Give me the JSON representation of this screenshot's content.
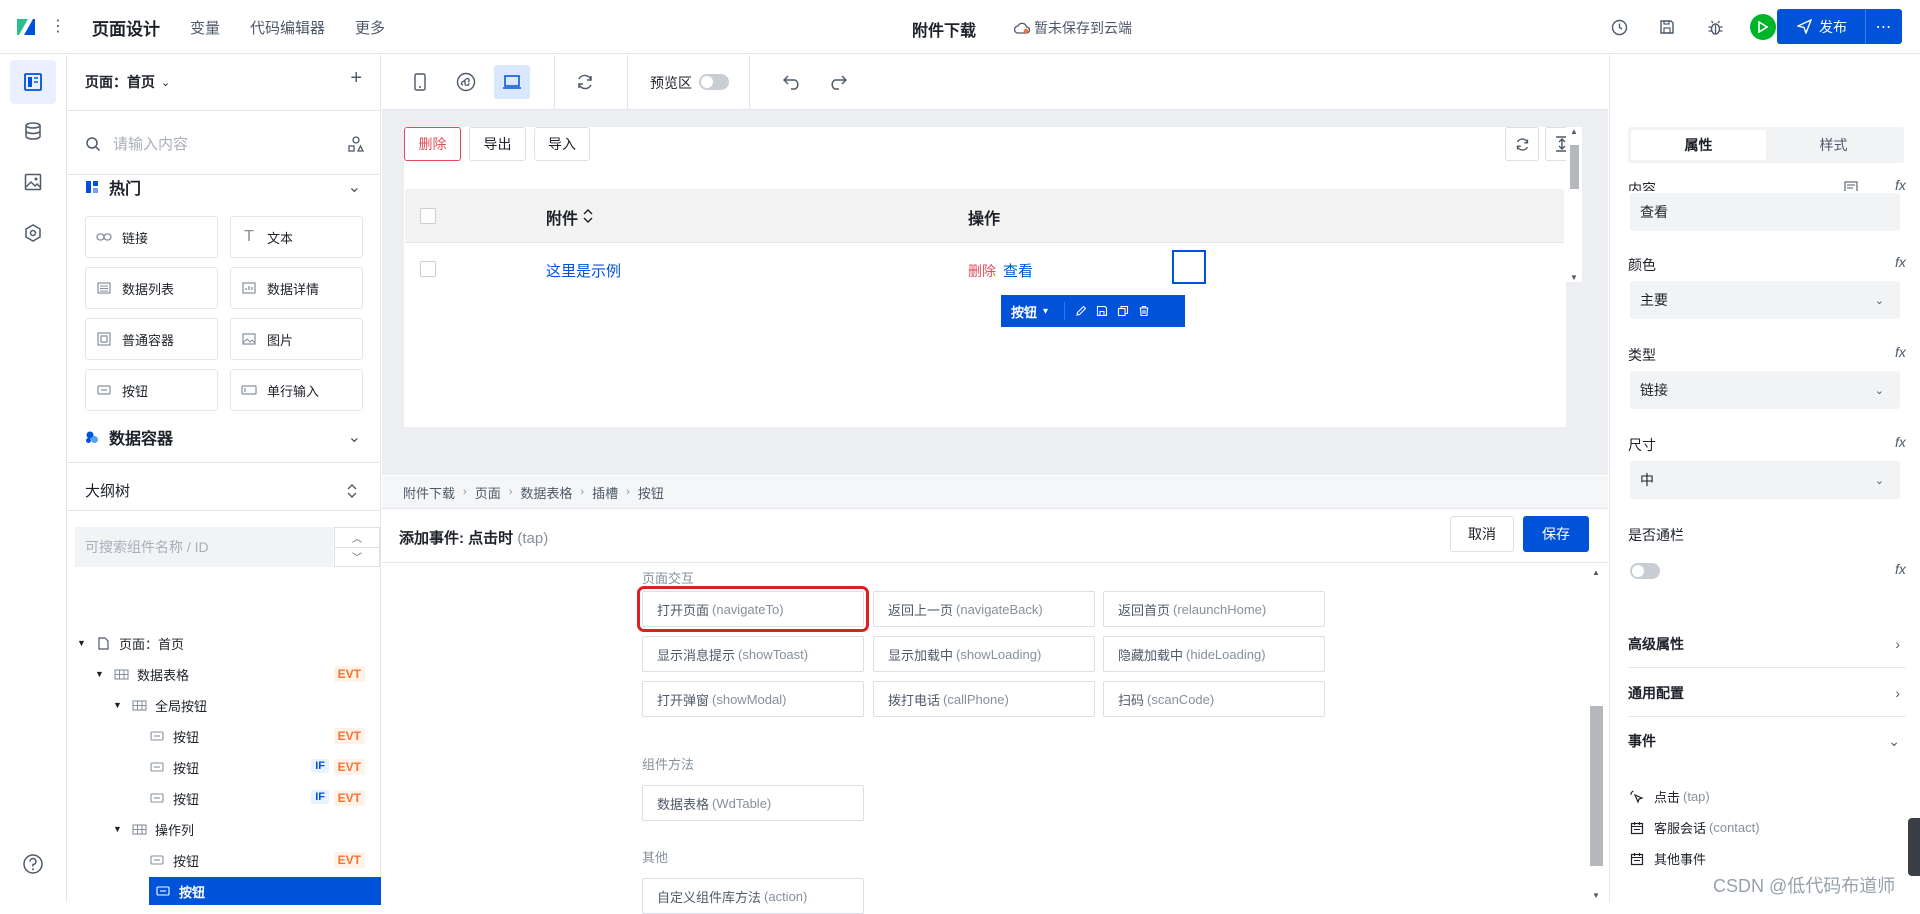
{
  "topbar": {
    "nav": [
      "页面设计",
      "变量",
      "代码编辑器",
      "更多"
    ],
    "app_title": "附件下载",
    "save_status": "暂未保存到云端",
    "publish_label": "发布",
    "more_label": "⋯"
  },
  "left_panel": {
    "page_selector": "页面：首页",
    "search_placeholder": "请输入内容",
    "hot_category": "热门",
    "components": [
      {
        "label": "链接",
        "icon": "link-icon"
      },
      {
        "label": "文本",
        "icon": "text-icon"
      },
      {
        "label": "数据列表",
        "icon": "data-list-icon"
      },
      {
        "label": "数据详情",
        "icon": "data-detail-icon"
      },
      {
        "label": "普通容器",
        "icon": "container-icon"
      },
      {
        "label": "图片",
        "icon": "image-icon"
      },
      {
        "label": "按钮",
        "icon": "button-icon"
      },
      {
        "label": "单行输入",
        "icon": "input-icon"
      }
    ],
    "data_container_category": "数据容器",
    "outline_title": "大纲树",
    "outline_search_placeholder": "可搜索组件名称 / ID",
    "tree": [
      {
        "label": "页面：首页",
        "level": 0,
        "evt": false,
        "if": false
      },
      {
        "label": "数据表格",
        "level": 1,
        "evt": true,
        "if": false
      },
      {
        "label": "全局按钮",
        "level": 2,
        "evt": false,
        "if": false
      },
      {
        "label": "按钮",
        "level": 3,
        "evt": true,
        "if": false
      },
      {
        "label": "按钮",
        "level": 3,
        "evt": true,
        "if": true
      },
      {
        "label": "按钮",
        "level": 3,
        "evt": true,
        "if": true
      },
      {
        "label": "操作列",
        "level": 2,
        "evt": false,
        "if": false
      },
      {
        "label": "按钮",
        "level": 3,
        "evt": true,
        "if": false
      },
      {
        "label": "按钮",
        "level": 3,
        "evt": false,
        "if": false,
        "selected": true
      }
    ],
    "tag_evt": "EVT",
    "tag_if": "IF"
  },
  "toolbar": {
    "preview_label": "预览区",
    "preview_on": false
  },
  "canvas": {
    "btn_delete": "删除",
    "btn_export": "导出",
    "btn_import": "导入",
    "col_attachment": "附件",
    "col_actions": "操作",
    "row_link": "这里是示例",
    "row_delete": "删除",
    "row_view": "查看",
    "component_bar_label": "按钮"
  },
  "breadcrumb": [
    "附件下载",
    "页面",
    "数据表格",
    "插槽",
    "按钮"
  ],
  "event_panel": {
    "title": "添加事件: 点击时",
    "title_sub": "(tap)",
    "cancel": "取消",
    "save": "保存",
    "sections": [
      {
        "title": "页面交互",
        "actions": [
          {
            "cn": "打开页面",
            "en": "(navigateTo)",
            "highlighted": true
          },
          {
            "cn": "返回上一页",
            "en": "(navigateBack)"
          },
          {
            "cn": "返回首页",
            "en": "(relaunchHome)"
          },
          {
            "cn": "显示消息提示",
            "en": "(showToast)"
          },
          {
            "cn": "显示加载中",
            "en": "(showLoading)"
          },
          {
            "cn": "隐藏加载中",
            "en": "(hideLoading)"
          },
          {
            "cn": "打开弹窗",
            "en": "(showModal)"
          },
          {
            "cn": "拨打电话",
            "en": "(callPhone)"
          },
          {
            "cn": "扫码",
            "en": "(scanCode)"
          }
        ]
      },
      {
        "title": "组件方法",
        "actions": [
          {
            "cn": "数据表格",
            "en": "(WdTable)"
          }
        ]
      },
      {
        "title": "其他",
        "actions": [
          {
            "cn": "自定义组件库方法",
            "en": "(action)"
          }
        ]
      }
    ]
  },
  "right_panel": {
    "tab_props": "属性",
    "tab_style": "样式",
    "content_label": "内容",
    "content_value": "查看",
    "color_label": "颜色",
    "color_value": "主要",
    "type_label": "类型",
    "type_value": "链接",
    "size_label": "尺寸",
    "size_value": "中",
    "block_label": "是否通栏",
    "block_on": false,
    "fx": "fx",
    "advanced": "高级属性",
    "common_config": "通用配置",
    "events": "事件",
    "event_items": [
      {
        "cn": "点击",
        "en": "(tap)",
        "icon": "pointer-click-icon"
      },
      {
        "cn": "客服会话",
        "en": "(contact)",
        "icon": "calendar-icon"
      },
      {
        "cn": "其他事件",
        "en": "",
        "icon": "calendar-icon"
      }
    ]
  },
  "watermark": "CSDN @低代码布道师",
  "colors": {
    "primary": "#0052d9",
    "danger": "#e34d59",
    "evt_tag": "#f77234",
    "run_green": "#00b42a",
    "highlight_red": "#e02020"
  }
}
